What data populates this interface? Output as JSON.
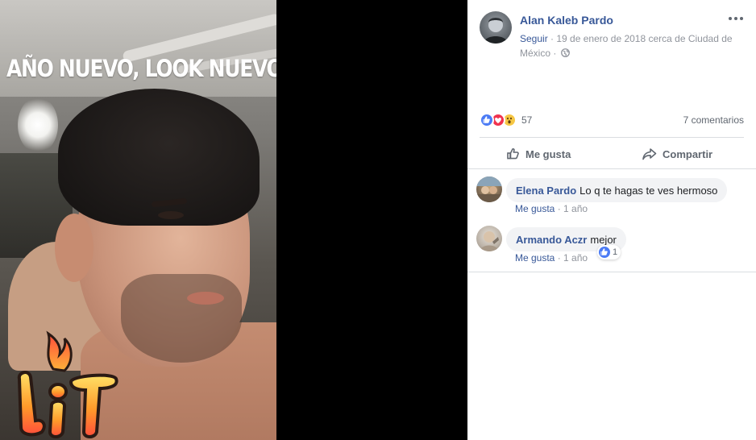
{
  "photo": {
    "caption": "AÑO NUEVO, LOOK NUEVO.",
    "sticker_text": "LIT"
  },
  "post": {
    "author": "Alan Kaleb Pardo",
    "follow": "Seguir",
    "separator": "·",
    "date_location": "19 de enero de 2018 cerca de Ciudad de México",
    "privacy_icon": "globe-icon",
    "more_icon": "more-options-icon"
  },
  "reactions": {
    "icons": [
      "like",
      "love",
      "wow"
    ],
    "count": "57",
    "comments_count": "7 comentarios"
  },
  "actions": {
    "like_label": "Me gusta",
    "share_label": "Compartir"
  },
  "comments": [
    {
      "name": "Elena Pardo",
      "text": "Lo q te hagas te ves hermoso",
      "like": "Me gusta",
      "sep": "·",
      "time": "1 año"
    },
    {
      "name": "Armando Aczr",
      "text": "mejor",
      "like": "Me gusta",
      "sep": "·",
      "time": "1 año",
      "reaction_count": "1"
    }
  ],
  "colors": {
    "link": "#385898",
    "muted": "#90949c",
    "like_blue": "#4b7bf5",
    "love_red": "#f0334f",
    "wow_yellow": "#f6c744"
  }
}
